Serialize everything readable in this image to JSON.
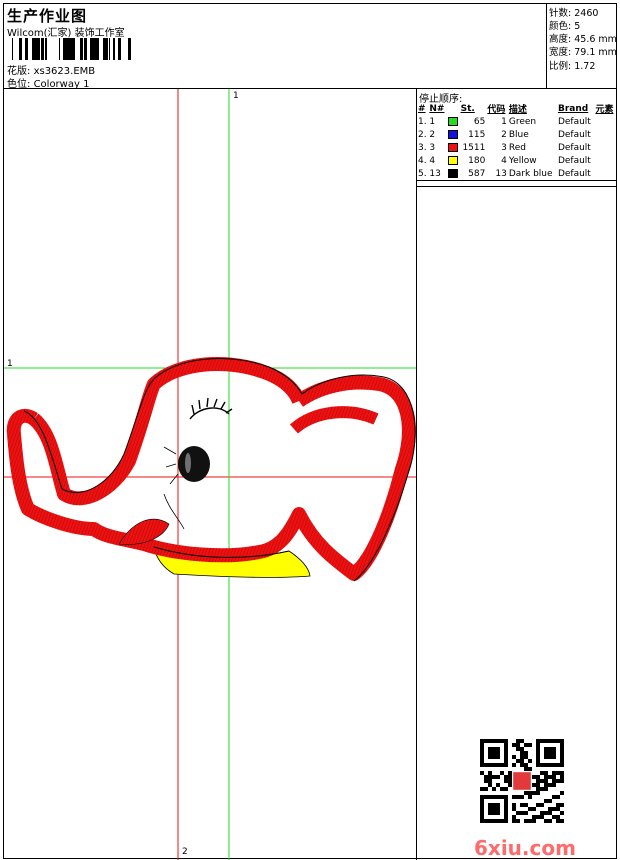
{
  "header": {
    "title": "生产作业图",
    "company": "Wilcom(汇家) 装饰工作室",
    "design_label": "花版:",
    "design_value": "xs3623.EMB",
    "colorway_label": "色位:",
    "colorway_value": "Colorway 1"
  },
  "stats": [
    {
      "label": "针数:",
      "value": "2460"
    },
    {
      "label": "颜色:",
      "value": "5"
    },
    {
      "label": "高度:",
      "value": "45.6 mm"
    },
    {
      "label": "宽度:",
      "value": "79.1 mm"
    },
    {
      "label": "比例:",
      "value": "1.72"
    }
  ],
  "stop_sequence": {
    "label": "停止顺序:",
    "columns": [
      "#",
      "N#",
      "St.",
      "代码",
      "描述",
      "Brand",
      "元素"
    ],
    "rows": [
      {
        "idx": "1.",
        "n": "1",
        "color": "#22dd22",
        "st": "65",
        "code": "1",
        "desc": "Green",
        "brand": "Default"
      },
      {
        "idx": "2.",
        "n": "2",
        "color": "#1010e0",
        "st": "115",
        "code": "2",
        "desc": "Blue",
        "brand": "Default"
      },
      {
        "idx": "3.",
        "n": "3",
        "color": "#ee1111",
        "st": "1511",
        "code": "3",
        "desc": "Red",
        "brand": "Default"
      },
      {
        "idx": "4.",
        "n": "4",
        "color": "#ffff00",
        "st": "180",
        "code": "4",
        "desc": "Yellow",
        "brand": "Default"
      },
      {
        "idx": "5.",
        "n": "13",
        "color": "#000000",
        "st": "587",
        "code": "13",
        "desc": "Dark blue",
        "brand": "Default"
      }
    ]
  },
  "canvas": {
    "axis_labels": {
      "green_vertical": "1",
      "green_horizontal": "1",
      "red_vertical": "2"
    }
  },
  "watermark": "6xiu.com",
  "colors": {
    "red": "#ee1111",
    "green": "#22dd22",
    "yellow": "#ffff00",
    "watermark": "#ff6b6b"
  }
}
